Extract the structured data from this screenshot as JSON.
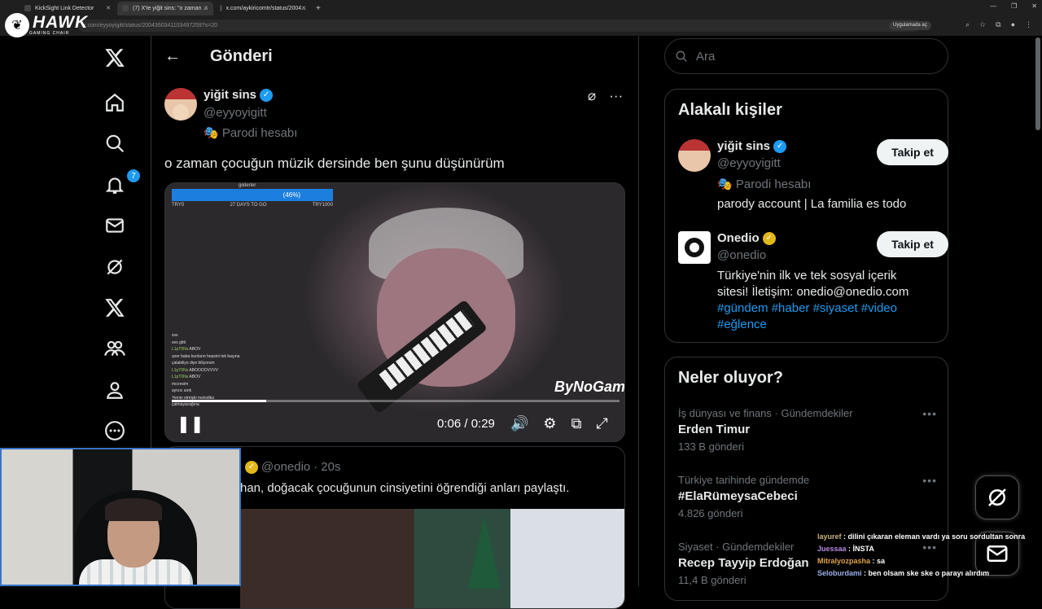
{
  "browser": {
    "tabs": [
      {
        "label": "KickSight Link Detector"
      },
      {
        "label": "(7) X'te yiğit sins: \"o zaman ..."
      },
      {
        "label": "x.com/aykiricomtr/status/2004..."
      }
    ],
    "url": "x.com/eyyoyigitt/status/2004360341103497259?s=20",
    "apps_button": "Uygulamada aç"
  },
  "overlay_logo": {
    "brand": "HAWK",
    "sub": "GAMING CHAIR"
  },
  "nav": {
    "notifications_count": "7",
    "icons": [
      "x-logo-icon",
      "home-icon",
      "search-icon",
      "bell-icon",
      "mail-icon",
      "grok-icon",
      "x-premium-icon",
      "communities-icon",
      "profile-icon",
      "more-icon"
    ]
  },
  "header": {
    "title": "Gönderi"
  },
  "post": {
    "name": "yiğit sins",
    "handle": "@eyyoyigitt",
    "parody": "Parodi hesabı",
    "text": "o zaman çocuğun müzik dersinde ben şunu düşünürüm",
    "video": {
      "current_time": "0:06",
      "duration": "0:29",
      "time_display": "0:06 / 0:29",
      "progress": 0.21,
      "hud_percent": "(46%)",
      "hud_left": "TRY0",
      "hud_mid": "27 DAYS TO GO",
      "hud_right": "TRY1000",
      "hud_top": "gilderler",
      "watermark": "ByNoGame",
      "chat": [
        {
          "user": "",
          "text": "sss"
        },
        {
          "user": "",
          "text": "ses gitti"
        },
        {
          "user": "L1pT0Ns",
          "text": "ABOV"
        },
        {
          "user": "",
          "text": "azer baba bunların hepsini tek başına"
        },
        {
          "user": "",
          "text": "çalabiliyo diye biliyorum"
        },
        {
          "user": "L1pT0Ns",
          "text": "ABOOOOVVVV"
        },
        {
          "user": "L1pT0Ns",
          "text": "ABOV"
        },
        {
          "user": "",
          "text": "mıcresim"
        },
        {
          "user": "",
          "text": "aynısı aınk"
        },
        {
          "user": "",
          "text": "Yemin etmişki melodika"
        },
        {
          "user": "",
          "text": "çalmayacağına"
        }
      ]
    }
  },
  "quoted": {
    "handle": "@onedio",
    "time": "20s",
    "text": "han, doğacak çocuğunun cinsiyetini öğrendiği anları paylaştı."
  },
  "search": {
    "placeholder": "Ara"
  },
  "related": {
    "title": "Alakalı kişiler",
    "people": [
      {
        "name": "yiğit sins",
        "handle": "@eyyoyigitt",
        "lines": [
          "Parodi hesabı",
          "parody account | La familia es todo"
        ],
        "follow": "Takip et"
      },
      {
        "name": "Onedio",
        "handle": "@onedio",
        "lines": [
          "Türkiye'nin ilk ve tek sosyal içerik",
          "sitesi! İletişim: onedio@onedio.com",
          "#gündem #haber #siyaset #video",
          "#eğlence"
        ],
        "follow": "Takip et"
      }
    ]
  },
  "trends": {
    "title": "Neler oluyor?",
    "items": [
      {
        "category": "İş dünyası ve finans · Gündemdekiler",
        "name": "Erden Timur",
        "count": "133 B gönderi"
      },
      {
        "category": "Türkiye tarihinde gündemde",
        "name": "#ElaRümeysaCebeci",
        "count": "4.826 gönderi"
      },
      {
        "category": "Siyaset · Gündemdekiler",
        "name": "Recep Tayyip Erdoğan",
        "count": "11,4 B gönderi"
      }
    ]
  },
  "stream_chat": [
    {
      "user": "layuref",
      "text": ": dilini çıkaran eleman vardı ya soru sordultan sonra"
    },
    {
      "user": "Juessaa",
      "text": ": İNSTA"
    },
    {
      "user": "Mitralyozpasha",
      "text": ": sa"
    },
    {
      "user": "Seloburdami",
      "text": ": ben olsam ske ske o parayı alırdım"
    }
  ],
  "colors": {
    "accent": "#1d9bf0",
    "gold_badge": "#e2b719",
    "background": "#000000",
    "border": "#2f3336"
  }
}
